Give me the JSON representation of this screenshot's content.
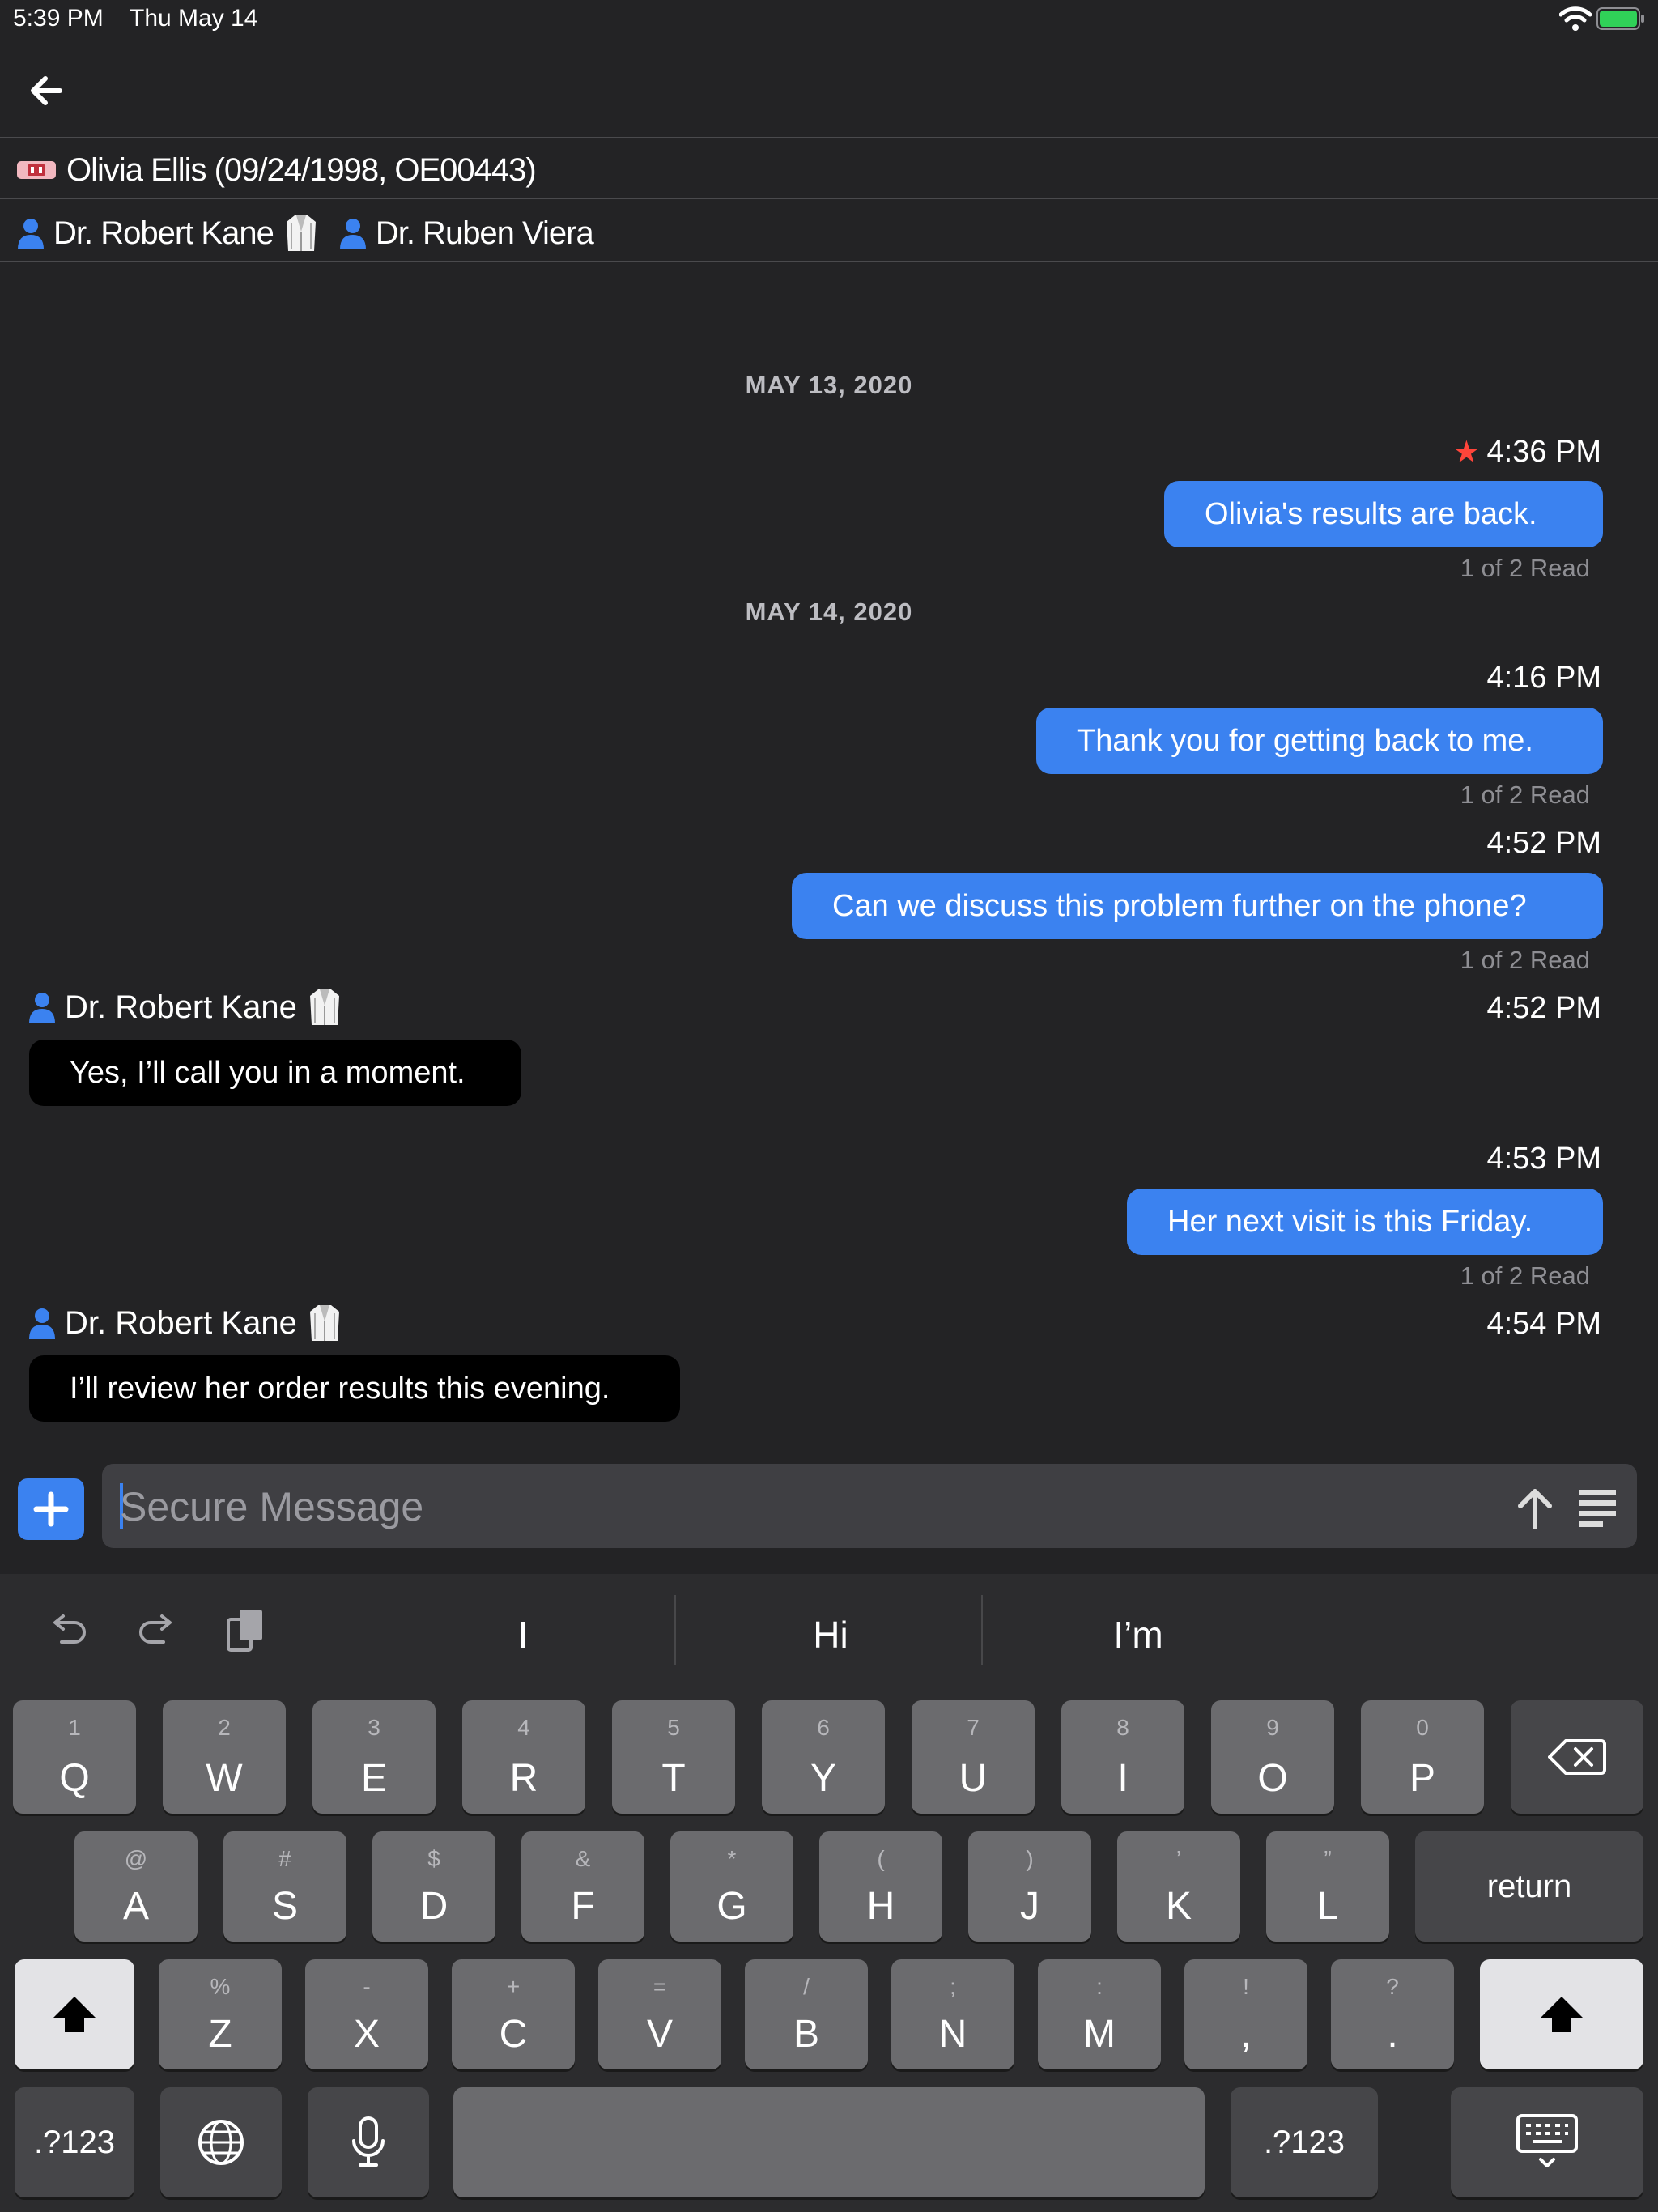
{
  "status": {
    "time": "5:39 PM",
    "date": "Thu May 14"
  },
  "header": {
    "patient": "Olivia Ellis (09/24/1998, OE00443)",
    "providers": [
      "Dr. Robert Kane",
      "Dr. Ruben Viera"
    ]
  },
  "messages": {
    "date1": "MAY 13, 2020",
    "date2": "MAY 14, 2020",
    "m1": {
      "time": "4:36 PM",
      "text": "Olivia's results are back.",
      "read": "1 of 2 Read"
    },
    "m2": {
      "time": "4:16 PM",
      "text": "Thank you for getting back to me.",
      "read": "1 of 2 Read"
    },
    "m3": {
      "time": "4:52 PM",
      "text": "Can we discuss this problem further on the phone?",
      "read": "1 of 2 Read"
    },
    "m4": {
      "sender": "Dr. Robert Kane",
      "time": "4:52 PM",
      "text": "Yes, I’ll call you in a moment."
    },
    "m5": {
      "time": "4:53 PM",
      "text": "Her next visit is this Friday.",
      "read": "1 of 2 Read"
    },
    "m6": {
      "sender": "Dr. Robert Kane",
      "time": "4:54 PM",
      "text": "I’ll review her order results this evening."
    }
  },
  "composer": {
    "placeholder": "Secure Message"
  },
  "keyboard": {
    "suggestions": [
      "I",
      "Hi",
      "I’m"
    ],
    "row1": [
      [
        "1",
        "Q"
      ],
      [
        "2",
        "W"
      ],
      [
        "3",
        "E"
      ],
      [
        "4",
        "R"
      ],
      [
        "5",
        "T"
      ],
      [
        "6",
        "Y"
      ],
      [
        "7",
        "U"
      ],
      [
        "8",
        "I"
      ],
      [
        "9",
        "O"
      ],
      [
        "0",
        "P"
      ]
    ],
    "row2": [
      [
        "@",
        "A"
      ],
      [
        "#",
        "S"
      ],
      [
        "$",
        "D"
      ],
      [
        "&",
        "F"
      ],
      [
        "*",
        "G"
      ],
      [
        "(",
        "H"
      ],
      [
        ")",
        "J"
      ],
      [
        "’",
        "K"
      ],
      [
        "”",
        "L"
      ]
    ],
    "row3": [
      [
        "%",
        "Z"
      ],
      [
        "-",
        "X"
      ],
      [
        "+",
        "C"
      ],
      [
        "=",
        "V"
      ],
      [
        "/",
        "B"
      ],
      [
        ";",
        "N"
      ],
      [
        ":",
        "M"
      ],
      [
        "!",
        ","
      ],
      [
        "?",
        "."
      ]
    ],
    "return_label": "return",
    "numbers_label": ".?123"
  },
  "colors": {
    "accent": "#3b82f0",
    "background": "#232325",
    "star": "#ff453a"
  }
}
